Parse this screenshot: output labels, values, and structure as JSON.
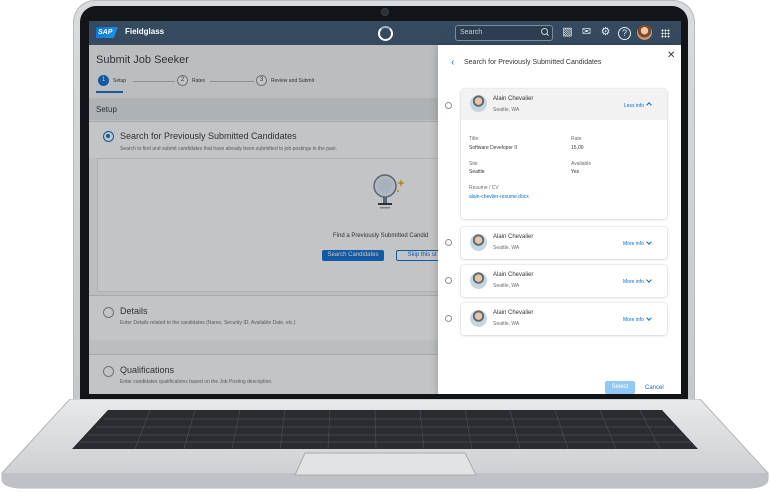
{
  "app": {
    "brand": "SAP",
    "product": "Fieldglass",
    "search_placeholder": "Search"
  },
  "page": {
    "title": "Submit Job Seeker",
    "steps": [
      {
        "num": "1",
        "label": "Setup"
      },
      {
        "num": "2",
        "label": "Rates"
      },
      {
        "num": "3",
        "label": "Review and Submit"
      }
    ],
    "section_title": "Setup",
    "option1": {
      "title": "Search for Previously Submitted Candidates",
      "desc": "Search to find and submit candidates that have already been submitted to job postings in the past.",
      "find_text": "Find a Previously Submitted Candid",
      "search_btn": "Search Candidates",
      "skip_btn": "Skip this st"
    },
    "option2": {
      "title": "Details",
      "desc": "Enter Details related to the candidates (Name, Security ID, Available Date, etc.)"
    },
    "option3": {
      "title": "Qualifications",
      "desc": "Enter candidates qualifications based on the Job Posting description."
    }
  },
  "panel": {
    "title": "Search for Previously Submitted Candidates",
    "candidates": [
      {
        "name": "Alain Chevalier",
        "location": "Seattle, WA",
        "toggle": "Less info",
        "expanded": true,
        "details": {
          "title_label": "Title",
          "title_value": "Software Developer II",
          "rate_label": "Rate",
          "rate_value": "15,00",
          "site_label": "Site",
          "site_value": "Seattle",
          "available_label": "Available",
          "available_value": "Yes",
          "resume_label": "Resume / CV",
          "resume_link": "alain-chevlier-resume.docx"
        }
      },
      {
        "name": "Alain Chevalier",
        "location": "Seattle, WA",
        "toggle": "More info"
      },
      {
        "name": "Alain Chevalier",
        "location": "Seattle, WA",
        "toggle": "More info"
      },
      {
        "name": "Alain Chevalier",
        "location": "Seattle, WA",
        "toggle": "More info"
      }
    ],
    "select_btn": "Select",
    "cancel_btn": "Cancel"
  },
  "icons": {
    "back": "chevron-left-icon",
    "close": "close-icon",
    "search": "search-icon",
    "notifications": "mail-icon",
    "settings": "gear-icon",
    "help": "help-icon",
    "apps": "grid-icon"
  },
  "colors": {
    "shell": "#354a5f",
    "accent": "#0a6ed1",
    "background": "#f5f6f7"
  }
}
